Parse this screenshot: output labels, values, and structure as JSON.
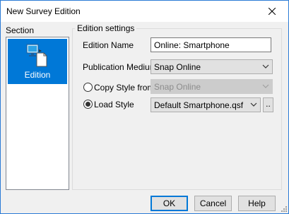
{
  "window": {
    "title": "New Survey Edition"
  },
  "sidebar": {
    "header": "Section",
    "items": [
      {
        "label": "Edition",
        "icon": "edition-icon",
        "selected": true
      }
    ]
  },
  "group": {
    "title": "Edition settings"
  },
  "form": {
    "edition_name_label": "Edition Name",
    "edition_name_value": "Online: Smartphone",
    "publication_medium_label": "Publication Medium",
    "publication_medium_value": "Snap Online",
    "copy_style_label": "Copy Style from",
    "copy_style_value": "Snap Online",
    "load_style_label": "Load Style",
    "load_style_value": "Default Smartphone.qsf",
    "browse_label": ".."
  },
  "buttons": {
    "ok": "OK",
    "cancel": "Cancel",
    "help": "Help"
  },
  "colors": {
    "accent": "#0078d7"
  }
}
